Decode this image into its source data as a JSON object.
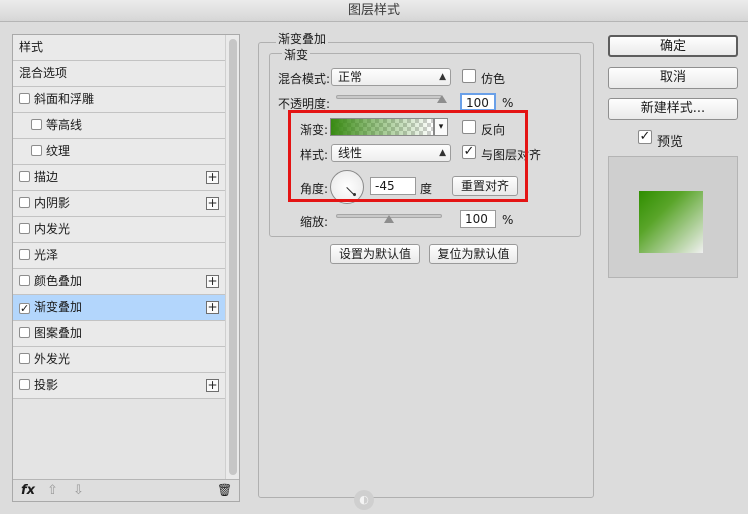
{
  "window": {
    "title": "图层样式"
  },
  "sidebar": {
    "items": [
      {
        "label": "样式",
        "checkbox": false,
        "checked": false,
        "plus": false,
        "indent": false,
        "selected": false
      },
      {
        "label": "混合选项",
        "checkbox": false,
        "checked": false,
        "plus": false,
        "indent": false,
        "selected": false
      },
      {
        "label": "斜面和浮雕",
        "checkbox": true,
        "checked": false,
        "plus": false,
        "indent": false,
        "selected": false
      },
      {
        "label": "等高线",
        "checkbox": true,
        "checked": false,
        "plus": false,
        "indent": true,
        "selected": false
      },
      {
        "label": "纹理",
        "checkbox": true,
        "checked": false,
        "plus": false,
        "indent": true,
        "selected": false
      },
      {
        "label": "描边",
        "checkbox": true,
        "checked": false,
        "plus": true,
        "indent": false,
        "selected": false
      },
      {
        "label": "内阴影",
        "checkbox": true,
        "checked": false,
        "plus": true,
        "indent": false,
        "selected": false
      },
      {
        "label": "内发光",
        "checkbox": true,
        "checked": false,
        "plus": false,
        "indent": false,
        "selected": false
      },
      {
        "label": "光泽",
        "checkbox": true,
        "checked": false,
        "plus": false,
        "indent": false,
        "selected": false
      },
      {
        "label": "颜色叠加",
        "checkbox": true,
        "checked": false,
        "plus": true,
        "indent": false,
        "selected": false
      },
      {
        "label": "渐变叠加",
        "checkbox": true,
        "checked": true,
        "plus": true,
        "indent": false,
        "selected": true
      },
      {
        "label": "图案叠加",
        "checkbox": true,
        "checked": false,
        "plus": false,
        "indent": false,
        "selected": false
      },
      {
        "label": "外发光",
        "checkbox": true,
        "checked": false,
        "plus": false,
        "indent": false,
        "selected": false
      },
      {
        "label": "投影",
        "checkbox": true,
        "checked": false,
        "plus": true,
        "indent": false,
        "selected": false
      }
    ],
    "footer": {
      "fx": "fx",
      "up": "⇧",
      "down": "⇩",
      "trash": "🗑"
    }
  },
  "panel": {
    "group_title": "渐变叠加",
    "subgroup_title": "渐变",
    "blend_mode_label": "混合模式:",
    "blend_mode_value": "正常",
    "dither_label": "仿色",
    "opacity_label": "不透明度:",
    "opacity_value": "100",
    "opacity_unit": "%",
    "gradient_label": "渐变:",
    "reverse_label": "反向",
    "style_label": "样式:",
    "style_value": "线性",
    "align_label": "与图层对齐",
    "angle_label": "角度:",
    "angle_value": "-45",
    "angle_unit": "度",
    "reset_align_button": "重置对齐",
    "scale_label": "缩放:",
    "scale_value": "100",
    "scale_unit": "%",
    "make_default_button": "设置为默认值",
    "reset_default_button": "复位为默认值",
    "opacity_level": 1.0,
    "scale_level": 0.5
  },
  "actions": {
    "ok": "确定",
    "cancel": "取消",
    "new_style": "新建样式...",
    "preview_label": "预览"
  },
  "colors": {
    "gradient_start": "#388a12",
    "selection": "#b3d6fc",
    "highlight_box": "#e41414"
  }
}
